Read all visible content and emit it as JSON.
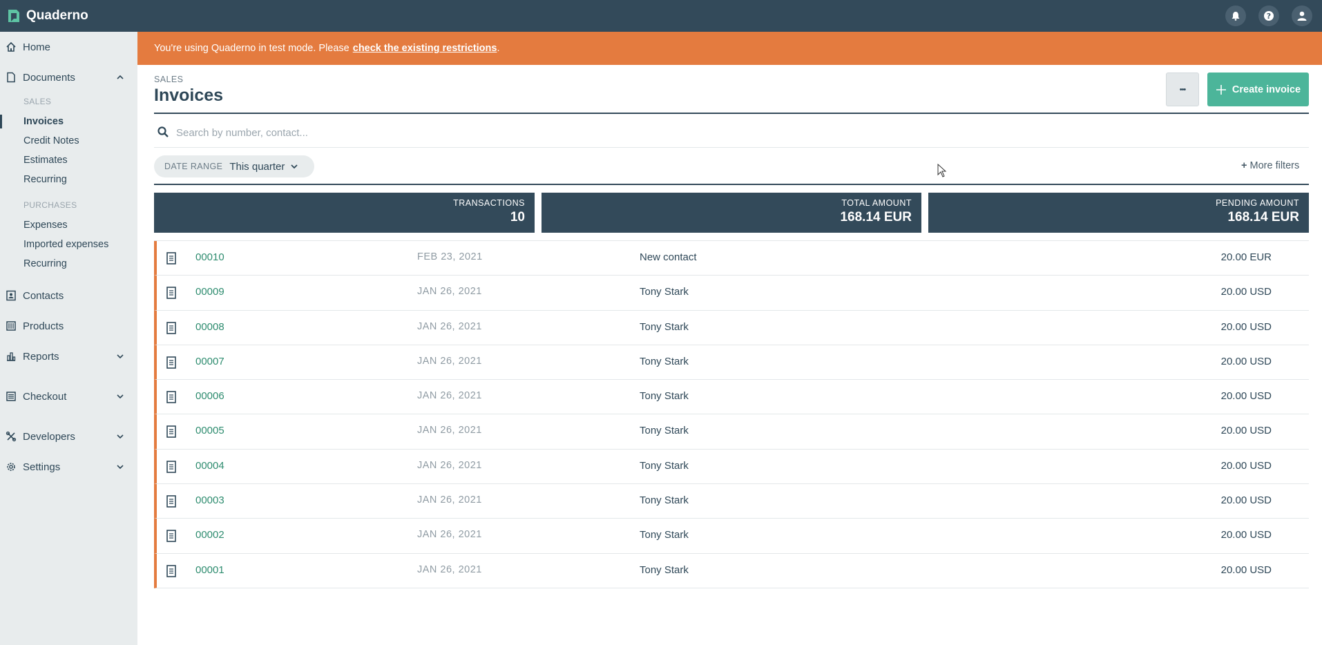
{
  "app": {
    "name": "Quaderno"
  },
  "sidebar": {
    "home": "Home",
    "documents": "Documents",
    "sales_label": "SALES",
    "sales_items": [
      "Invoices",
      "Credit Notes",
      "Estimates",
      "Recurring"
    ],
    "purchases_label": "PURCHASES",
    "purchase_items": [
      "Expenses",
      "Imported expenses",
      "Recurring"
    ],
    "contacts": "Contacts",
    "products": "Products",
    "reports": "Reports",
    "checkout": "Checkout",
    "developers": "Developers",
    "settings": "Settings"
  },
  "banner": {
    "text": "You're using Quaderno in test mode. Please",
    "link": "check the existing restrictions",
    "end": "."
  },
  "header": {
    "breadcrumb": "SALES",
    "title": "Invoices",
    "more_label": "•••",
    "create_label": "Create invoice"
  },
  "search": {
    "placeholder": "Search by number, contact..."
  },
  "filters": {
    "date_range_label": "DATE RANGE",
    "date_range_value": "This quarter",
    "more_filters": "More filters"
  },
  "stats": [
    {
      "label": "TRANSACTIONS",
      "value": "10"
    },
    {
      "label": "TOTAL AMOUNT",
      "value": "168.14 EUR"
    },
    {
      "label": "PENDING AMOUNT",
      "value": "168.14 EUR"
    }
  ],
  "invoices": [
    {
      "number": "00010",
      "date": "FEB 23, 2021",
      "contact": "New contact",
      "amount": "20.00 EUR"
    },
    {
      "number": "00009",
      "date": "JAN 26, 2021",
      "contact": "Tony Stark",
      "amount": "20.00 USD"
    },
    {
      "number": "00008",
      "date": "JAN 26, 2021",
      "contact": "Tony Stark",
      "amount": "20.00 USD"
    },
    {
      "number": "00007",
      "date": "JAN 26, 2021",
      "contact": "Tony Stark",
      "amount": "20.00 USD"
    },
    {
      "number": "00006",
      "date": "JAN 26, 2021",
      "contact": "Tony Stark",
      "amount": "20.00 USD"
    },
    {
      "number": "00005",
      "date": "JAN 26, 2021",
      "contact": "Tony Stark",
      "amount": "20.00 USD"
    },
    {
      "number": "00004",
      "date": "JAN 26, 2021",
      "contact": "Tony Stark",
      "amount": "20.00 USD"
    },
    {
      "number": "00003",
      "date": "JAN 26, 2021",
      "contact": "Tony Stark",
      "amount": "20.00 USD"
    },
    {
      "number": "00002",
      "date": "JAN 26, 2021",
      "contact": "Tony Stark",
      "amount": "20.00 USD"
    },
    {
      "number": "00001",
      "date": "JAN 26, 2021",
      "contact": "Tony Stark",
      "amount": "20.00 USD"
    }
  ],
  "colors": {
    "topbar": "#334a5a",
    "banner": "#e47b3f",
    "accent": "#4cb59a",
    "link": "#2e8c6f"
  }
}
